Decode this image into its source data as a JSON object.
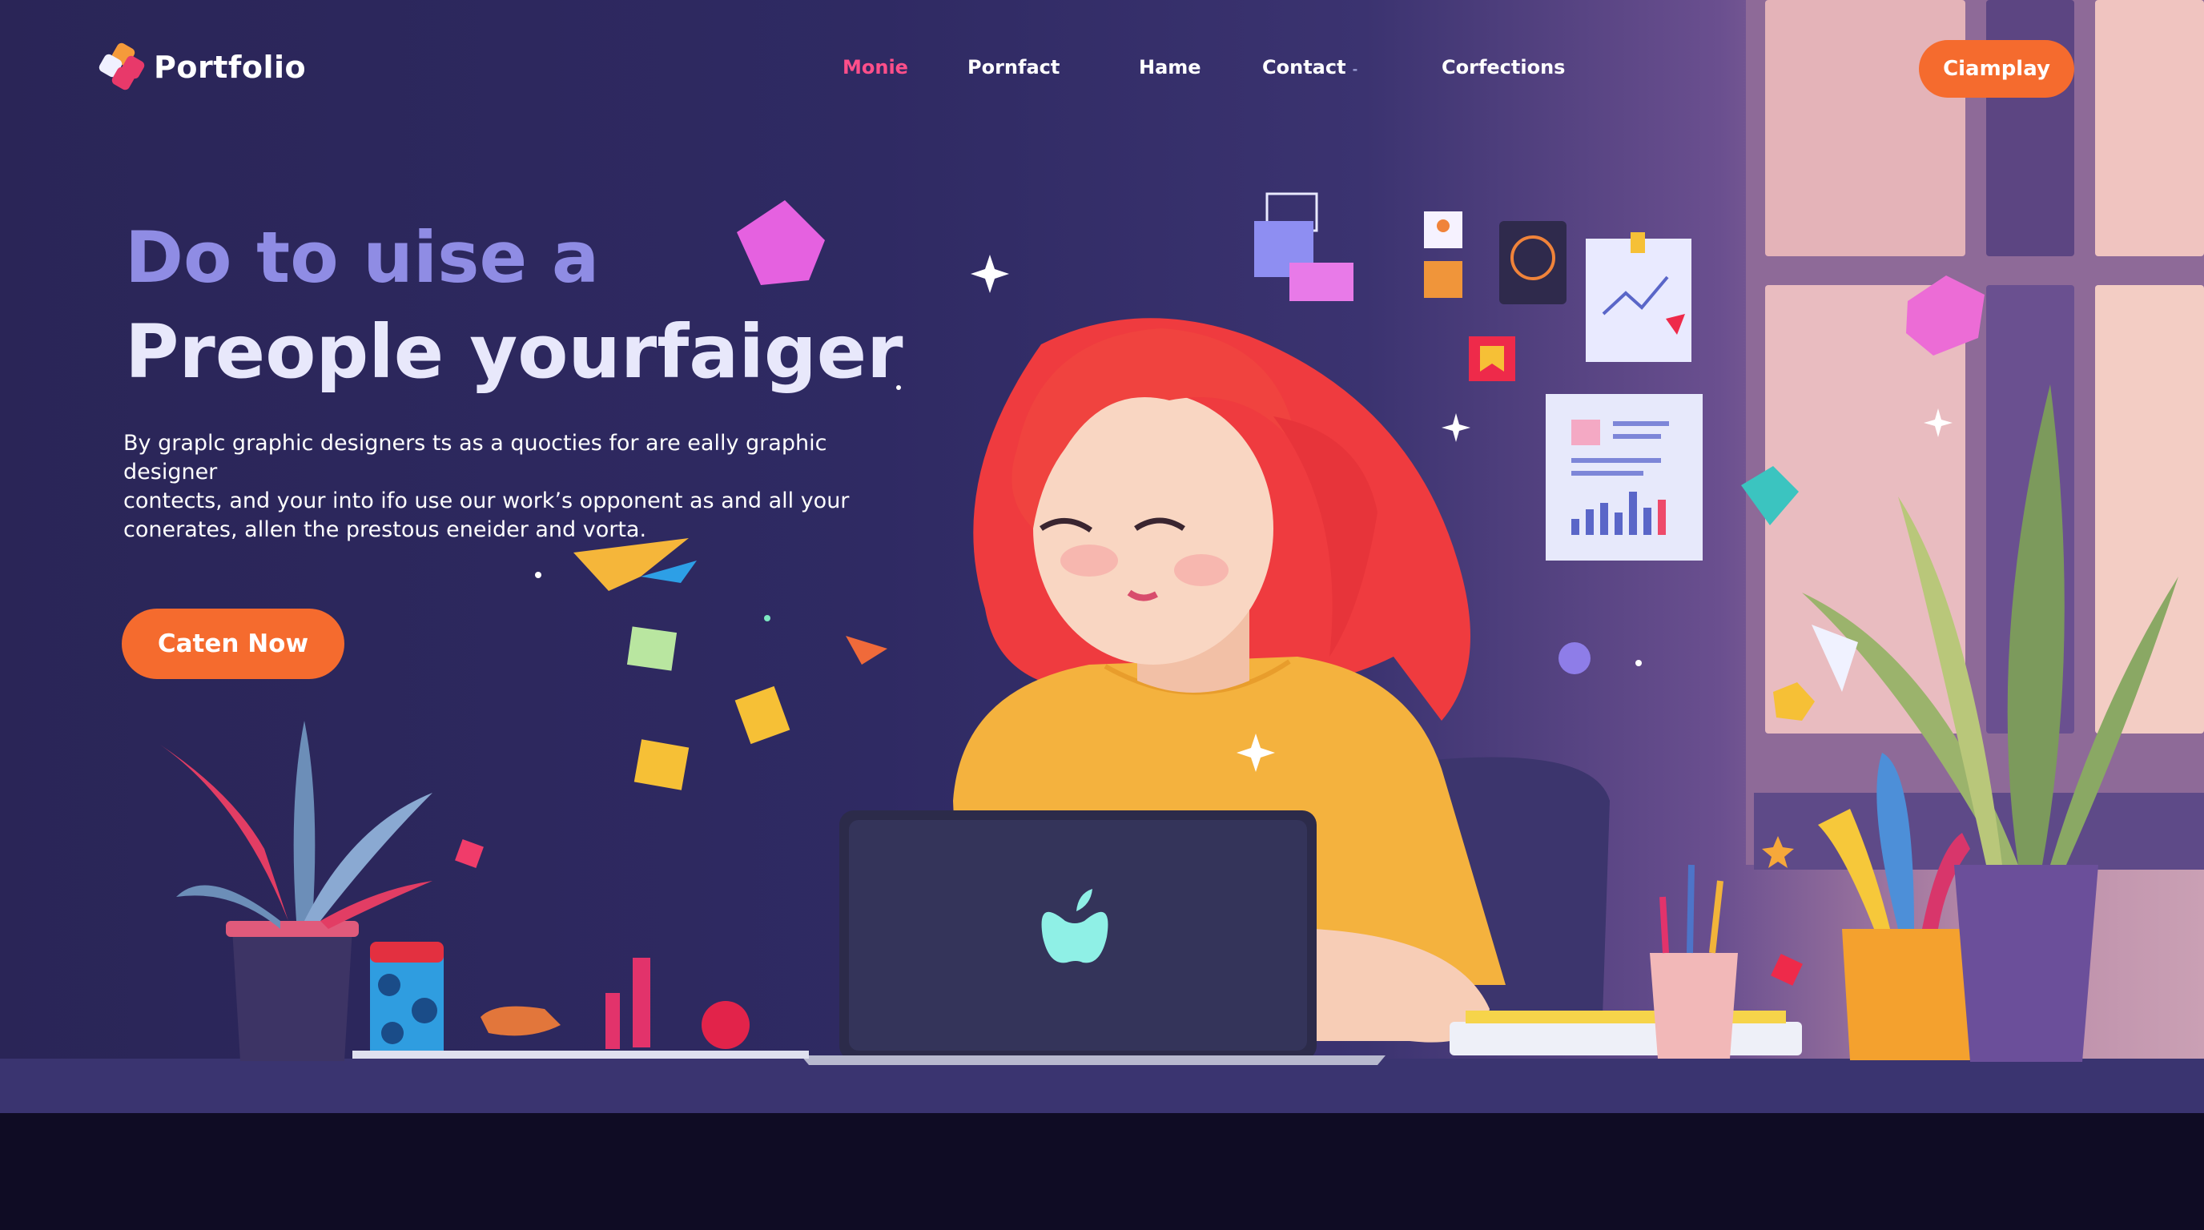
{
  "brand": {
    "name": "Portfolio"
  },
  "nav": {
    "links": [
      {
        "label": "Monie",
        "active": true
      },
      {
        "label": "Pornfact",
        "active": false
      },
      {
        "label": "Hame",
        "active": false
      },
      {
        "label": "Contact",
        "active": false,
        "caret": "-"
      },
      {
        "label": "Corfections",
        "active": false
      }
    ],
    "cta_label": "Ciamplay"
  },
  "hero": {
    "headline_line1": "Do to uise a",
    "headline_line2": "Preople yourfaiger",
    "body_lines": [
      "By graplc graphic designers  ts as a quocties for are eally graphic designer",
      "contects, and your into ifo use our work’s opponent as and all your",
      "conerates, allen the prestous eneider and vorta."
    ],
    "cta_label": "Caten Now"
  },
  "colors": {
    "accent": "#f56b2e",
    "active_nav": "#ff4f8a",
    "headline_muted": "#8f8ce4",
    "background": "#2b2657"
  },
  "illustration": {
    "subject": "woman with red hair working on laptop at desk",
    "icons": [
      "apple-logo-icon",
      "chart-card-icon",
      "document-card-icon",
      "paper-plane-icon"
    ]
  }
}
